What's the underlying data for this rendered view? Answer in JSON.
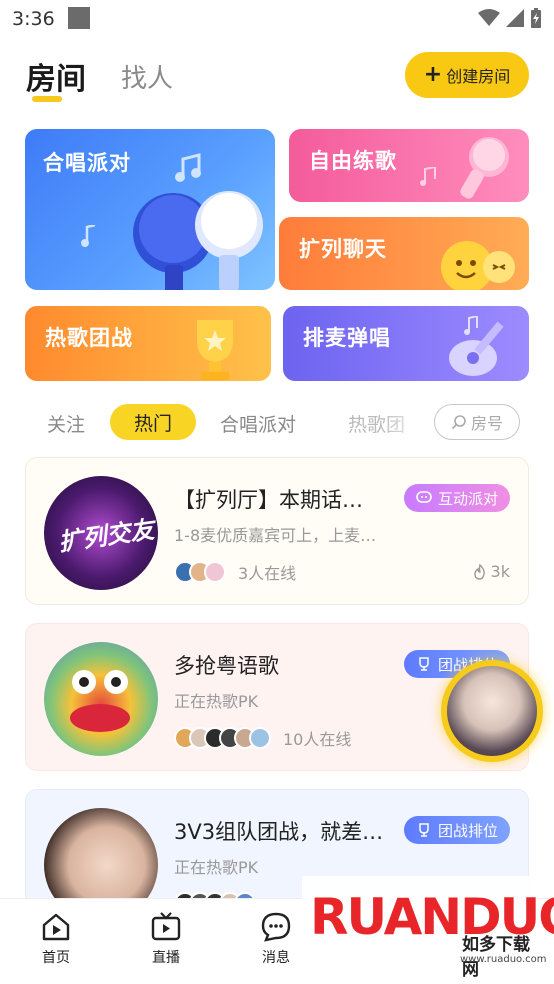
{
  "status_bar": {
    "time": "3:36"
  },
  "top_tabs": {
    "active": "房间",
    "other": "找人",
    "create_label": "创建房间",
    "accent": "#f8c813"
  },
  "cards": {
    "hechang": "合唱派对",
    "free_practice": "自由练歌",
    "chat": "扩列聊天",
    "hot_battle": "热歌团战",
    "mic_sing": "排麦弹唱"
  },
  "filters": {
    "follow": "关注",
    "hot": "热门",
    "chorus": "合唱派对",
    "hot_battle_partial": "热歌团",
    "search_placeholder": "房号"
  },
  "rooms": [
    {
      "avatar_text": "扩列交友",
      "title": "【扩列厅】本期话…",
      "subtitle": "1-8麦优质嘉宾可上，上麦…",
      "online": "3人在线",
      "badge": "互动派对",
      "heat": "3k"
    },
    {
      "title": "多抢粤语歌",
      "subtitle": "正在热歌PK",
      "online": "10人在线",
      "badge": "团战排位"
    },
    {
      "title": "3V3组队团战，就差…",
      "subtitle": "正在热歌PK",
      "badge": "团战排位"
    }
  ],
  "bottom_nav": {
    "home": "首页",
    "live": "直播",
    "messages": "消息"
  },
  "watermark": {
    "logo": "RUANDUO",
    "cn": "如多下载网",
    "url": "www.ruaduo.com"
  }
}
